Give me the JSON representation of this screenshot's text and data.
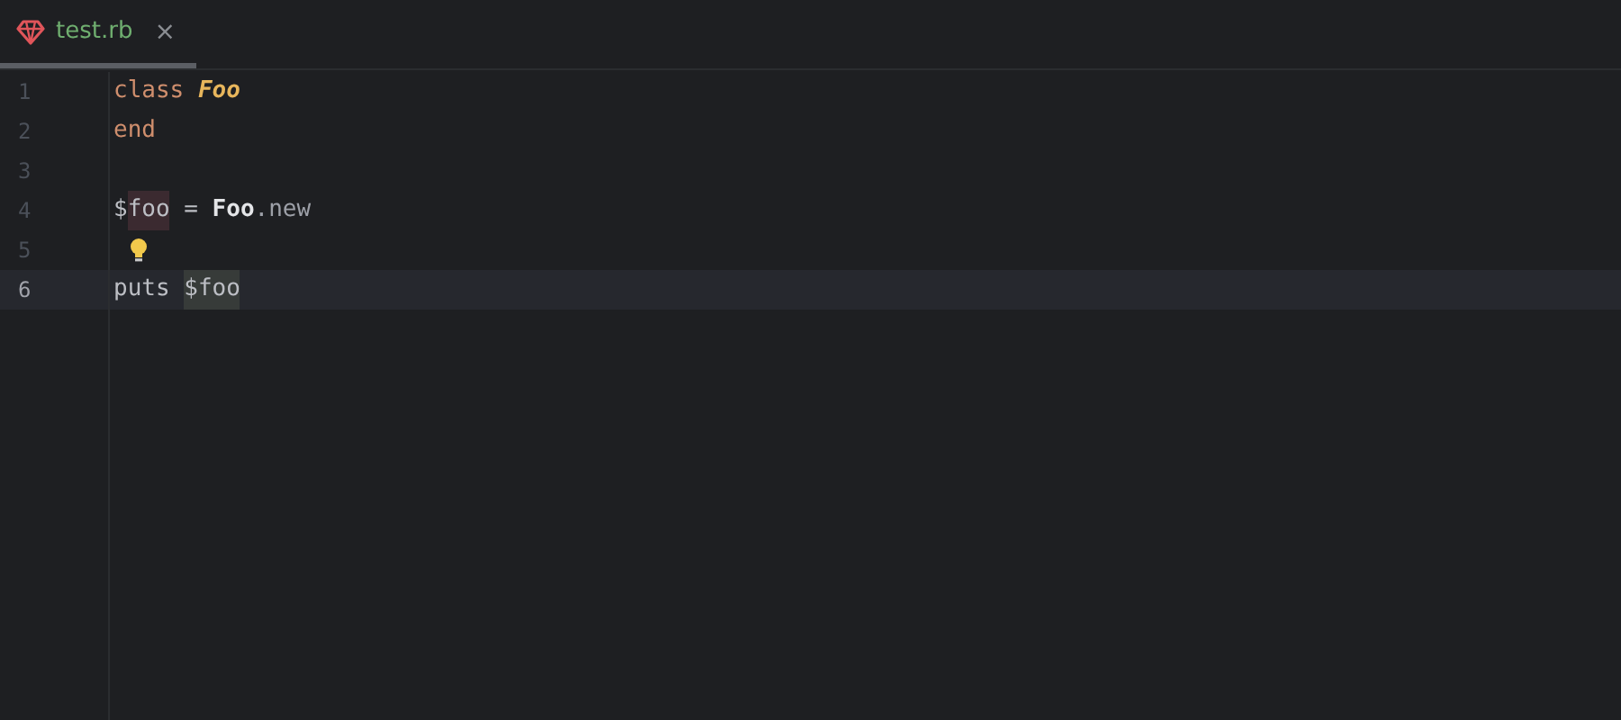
{
  "tabs": [
    {
      "label": "test.rb",
      "selected": true,
      "close": "×"
    }
  ],
  "editor": {
    "lines": [
      {
        "number": "1",
        "current": false,
        "bulb": false,
        "tokens": [
          {
            "text": "class ",
            "kind": "keyword",
            "highlighted": false
          },
          {
            "text": "Foo",
            "kind": "class-name",
            "highlighted": false
          }
        ]
      },
      {
        "number": "2",
        "current": false,
        "bulb": false,
        "tokens": [
          {
            "text": "end",
            "kind": "keyword",
            "highlighted": false
          }
        ]
      },
      {
        "number": "3",
        "current": false,
        "bulb": false
      },
      {
        "number": "4",
        "current": false,
        "bulb": false,
        "tokens": [
          {
            "text": "$",
            "kind": "plain",
            "highlighted": false
          },
          {
            "text": "foo",
            "kind": "plain",
            "highlighted": true,
            "color": "#3b2a30"
          },
          {
            "text": " = ",
            "kind": "plain",
            "highlighted": false
          },
          {
            "text": "Foo",
            "kind": "constant",
            "highlighted": false
          },
          {
            "text": ".new",
            "kind": "method",
            "highlighted": false
          }
        ]
      },
      {
        "number": "5",
        "current": false,
        "bulb": true
      },
      {
        "number": "6",
        "current": true,
        "bulb": false,
        "tokens": [
          {
            "text": "puts ",
            "kind": "plain",
            "highlighted": false
          },
          {
            "text": "$foo",
            "kind": "plain",
            "highlighted": true,
            "color": "#373b39"
          }
        ]
      }
    ]
  }
}
